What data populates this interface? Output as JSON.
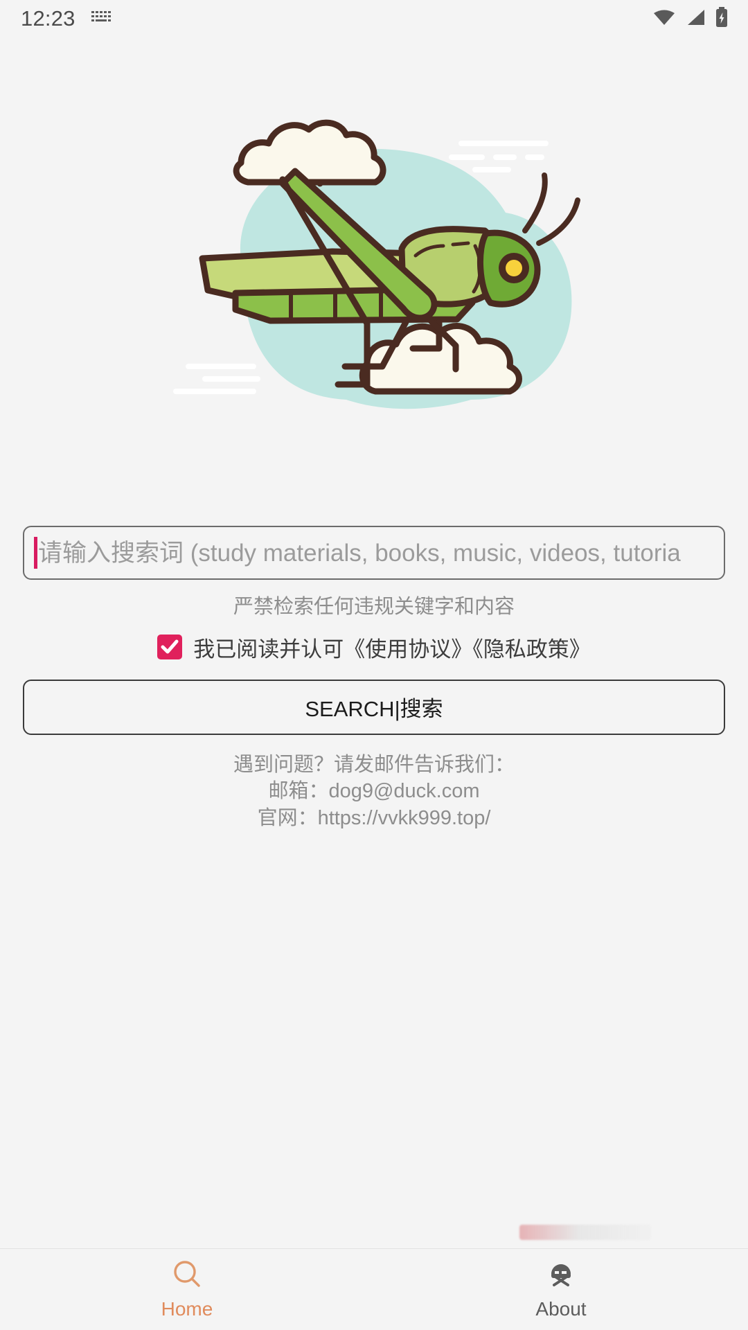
{
  "status_bar": {
    "time": "12:23",
    "icons": {
      "keyboard": "keyboard-icon",
      "wifi": "wifi-icon",
      "cellular": "cellular-signal-icon",
      "battery": "battery-charging-icon"
    }
  },
  "hero": {
    "illustration_name": "grasshopper-illustration",
    "colors": {
      "blob": "#bfe6e1",
      "body_light": "#b7cf6e",
      "body_mid": "#8cc04a",
      "body_dark": "#6faa35",
      "head": "#7fb03a",
      "outline": "#4a2b21",
      "cloud": "#fbf8ec",
      "eye": "#f7d13c"
    }
  },
  "search": {
    "placeholder": "请输入搜索词 (study materials, books, music, videos, tutoria",
    "value": "",
    "caret_color": "#d81b60"
  },
  "warning": {
    "text": "严禁检索任何违规关键字和内容"
  },
  "agreement": {
    "checked": true,
    "checkbox_color": "#e0215c",
    "label": "我已阅读并认可《使用协议》《隐私政策》"
  },
  "actions": {
    "search_button_label": "SEARCH|搜索"
  },
  "footer": {
    "lines": [
      "遇到问题？请发邮件告诉我们：",
      "邮箱：dog9@duck.com",
      "官网：https://vvkk999.top/"
    ],
    "line1": "遇到问题？请发邮件告诉我们：",
    "line2": "邮箱：dog9@duck.com",
    "line3": "官网：https://vvkk999.top/"
  },
  "bottom_nav": {
    "active_color": "#e08b5c",
    "inactive_color": "#5c5c5c",
    "items": [
      {
        "label": "Home",
        "icon": "search-icon",
        "active": true
      },
      {
        "label": "About",
        "icon": "info-person-icon",
        "active": false
      }
    ]
  }
}
